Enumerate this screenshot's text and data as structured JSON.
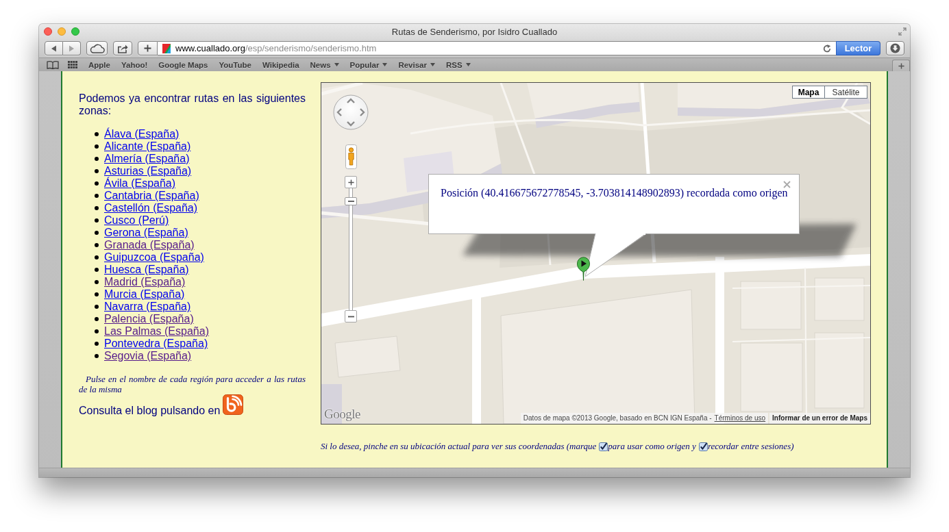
{
  "window": {
    "title": "Rutas de Senderismo, por Isidro Cuallado"
  },
  "toolbar": {
    "history_buttons": [
      {
        "kind": "back",
        "disabled": false
      },
      {
        "kind": "forward",
        "disabled": true
      }
    ],
    "url_host": "www.cuallado.org",
    "url_path": "/esp/senderismo/senderismo.htm",
    "reader_button": "Lector"
  },
  "bookmarks": [
    {
      "label": "Apple",
      "kind": "link"
    },
    {
      "label": "Yahoo!",
      "kind": "link"
    },
    {
      "label": "Google Maps",
      "kind": "link"
    },
    {
      "label": "YouTube",
      "kind": "link"
    },
    {
      "label": "Wikipedia",
      "kind": "link"
    },
    {
      "label": "News",
      "kind": "menu"
    },
    {
      "label": "Popular",
      "kind": "menu"
    },
    {
      "label": "Revisar",
      "kind": "menu"
    },
    {
      "label": "RSS",
      "kind": "menu"
    }
  ],
  "sidebar": {
    "intro": "Podemos ya encontrar rutas en las siguientes zonas:",
    "regions": [
      {
        "label": "Álava (España)",
        "visited": false
      },
      {
        "label": "Alicante (España)",
        "visited": false
      },
      {
        "label": "Almería (España)",
        "visited": false
      },
      {
        "label": "Asturias (España)",
        "visited": false
      },
      {
        "label": "Ávila (España)",
        "visited": false
      },
      {
        "label": "Cantabria (España)",
        "visited": false
      },
      {
        "label": "Castellón (España)",
        "visited": false
      },
      {
        "label": "Cusco (Perú)",
        "visited": false
      },
      {
        "label": "Gerona (España)",
        "visited": false
      },
      {
        "label": "Granada (España)",
        "visited": true
      },
      {
        "label": "Guipuzcoa (España)",
        "visited": false
      },
      {
        "label": "Huesca (España)",
        "visited": false
      },
      {
        "label": "Madrid (España)",
        "visited": true
      },
      {
        "label": "Murcia (España)",
        "visited": false
      },
      {
        "label": "Navarra (España)",
        "visited": false
      },
      {
        "label": "Palencia (España)",
        "visited": true
      },
      {
        "label": "Las Palmas (España)",
        "visited": true
      },
      {
        "label": "Pontevedra (España)",
        "visited": false
      },
      {
        "label": "Segovia (España)",
        "visited": true
      }
    ],
    "note": "Pulse en el nombre de cada región para acceder a las rutas de la misma",
    "blog_text": "Consulta el blog pulsando en"
  },
  "map": {
    "map_types": [
      {
        "label": "Mapa",
        "selected": true
      },
      {
        "label": "Satélite",
        "selected": false
      }
    ],
    "zoom_slider": {
      "level": 0.92
    },
    "info_window": {
      "text": "Posición (40.416675672778545, -3.703814148902893) recordada como origen"
    },
    "logo": "Google",
    "attribution": "Datos de mapa ©2013 Google, basado en BCN IGN España -",
    "terms_link": "Términos de uso",
    "report_link": "Informar de un error de Maps"
  },
  "footer": [
    {
      "kind": "text",
      "text": "Si lo desea, pinche en su ubicación actual para ver sus coordenadas (marque"
    },
    {
      "kind": "checkbox",
      "checked": true
    },
    {
      "kind": "text",
      "text": "para usar como origen y"
    },
    {
      "kind": "checkbox",
      "checked": true
    },
    {
      "kind": "text",
      "text": "recordar entre sesiones)"
    }
  ]
}
